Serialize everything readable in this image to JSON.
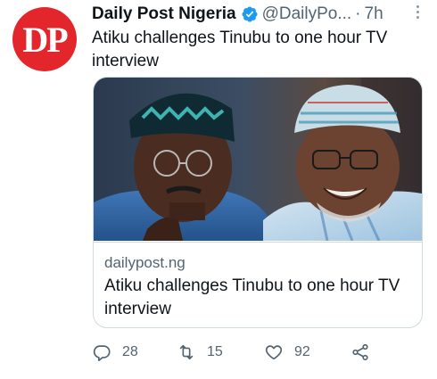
{
  "author": {
    "avatar_text": "DP",
    "avatar_color": "#e3262b",
    "name": "Daily Post Nigeria",
    "handle": "@DailyPo...",
    "separator": "·",
    "time": "7h"
  },
  "tweet": {
    "text": "Atiku challenges Tinubu to one hour TV interview"
  },
  "card": {
    "domain": "dailypost.ng",
    "title": "Atiku challenges Tinubu to one hour TV interview"
  },
  "actions": {
    "reply_count": "28",
    "retweet_count": "15",
    "like_count": "92"
  },
  "colors": {
    "verified": "#1d9bf0",
    "muted": "#536471",
    "border": "#cfd9de"
  },
  "icons": [
    "verified-badge-icon",
    "more-icon",
    "reply-icon",
    "retweet-icon",
    "like-icon",
    "share-icon"
  ]
}
